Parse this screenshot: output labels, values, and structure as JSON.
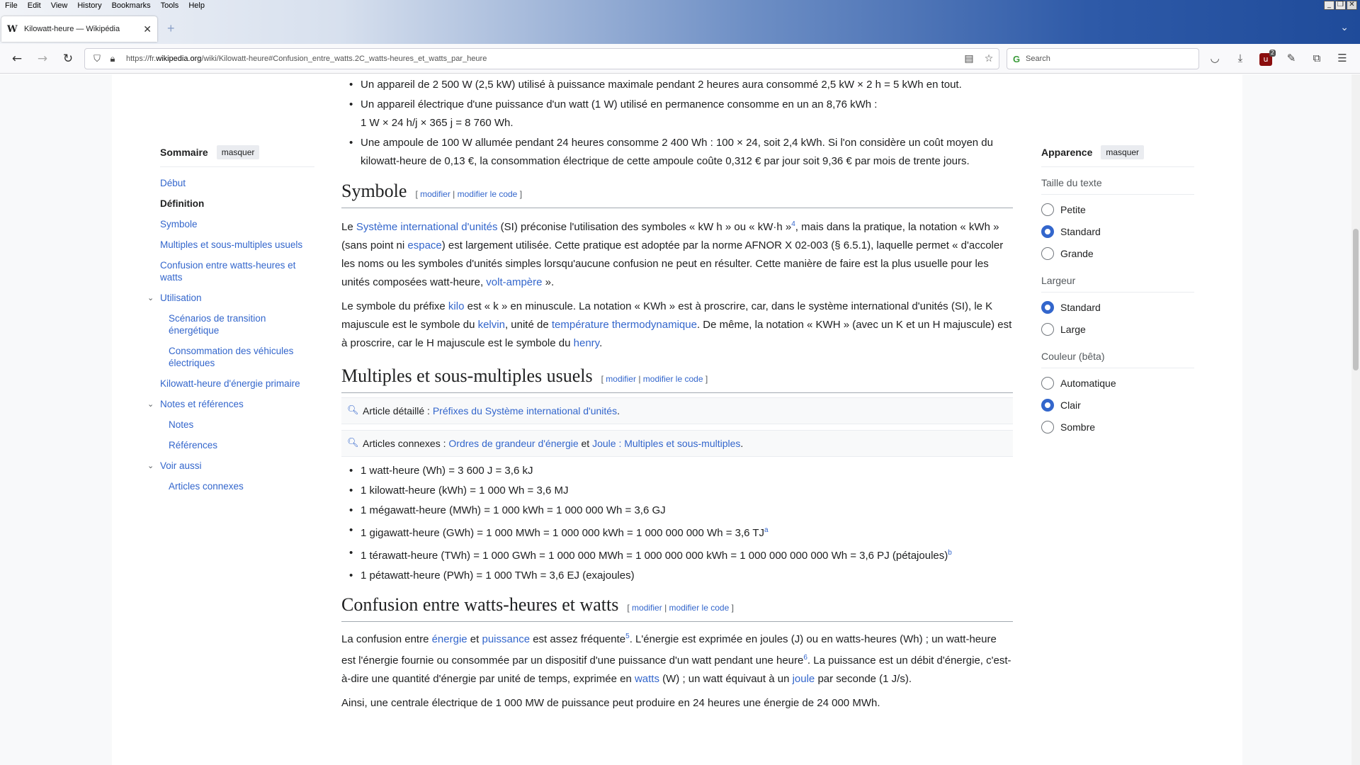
{
  "browser": {
    "menu": [
      "File",
      "Edit",
      "View",
      "History",
      "Bookmarks",
      "Tools",
      "Help"
    ],
    "tab_title": "Kilowatt-heure — Wikipédia",
    "tab_favicon": "W",
    "url_prefix": "https://fr.",
    "url_domain": "wikipedia.org",
    "url_path": "/wiki/Kilowatt-heure#Confusion_entre_watts.2C_watts-heures_et_watts_par_heure",
    "search_placeholder": "Search",
    "ublock_badge": "2"
  },
  "toc": {
    "title": "Sommaire",
    "hide": "masquer",
    "items": [
      {
        "label": "Début"
      },
      {
        "label": "Définition"
      },
      {
        "label": "Symbole"
      },
      {
        "label": "Multiples et sous-multiples usuels"
      },
      {
        "label": "Confusion entre watts-heures et watts"
      },
      {
        "label": "Utilisation"
      },
      {
        "label": "Scénarios de transition énergétique"
      },
      {
        "label": "Consommation des véhicules électriques"
      },
      {
        "label": "Kilowatt-heure d'énergie primaire"
      },
      {
        "label": "Notes et références"
      },
      {
        "label": "Notes"
      },
      {
        "label": "Références"
      },
      {
        "label": "Voir aussi"
      },
      {
        "label": "Articles connexes"
      }
    ]
  },
  "content": {
    "top_list": [
      "Un appareil de 2 500 W (2,5 kW) utilisé à puissance maximale pendant 2 heures aura consommé 2,5 kW × 2 h = 5 kWh en tout.",
      "Un appareil électrique d'une puissance d'un watt (1 W) utilisé en permanence consomme en un an 8,76 kWh :",
      "1 W × 24 h/j × 365 j = 8 760 Wh.",
      "Une ampoule de 100 W allumée pendant 24 heures consomme 2 400 Wh : 100 × 24, soit 2,4 kWh. Si l'on considère un coût moyen du kilowatt-heure de 0,13 €, la consommation électrique de cette ampoule coûte 0,312 € par jour soit 9,36 € par mois de trente jours."
    ],
    "edit_open": "[",
    "edit_sep": "|",
    "edit_close": "]",
    "edit_modifier": "modifier",
    "edit_code": "modifier le code",
    "symbole": {
      "heading": "Symbole",
      "p1_a": "Le ",
      "p1_link1": "Système international d'unités",
      "p1_b": " (SI) préconise l'utilisation des symboles « kW h » ou « kW·h »",
      "p1_sup": "4",
      "p1_c": ", mais dans la pratique, la notation « kWh » (sans point ni ",
      "p1_link2": "espace",
      "p1_d": ") est largement utilisée. Cette pratique est adoptée par la norme AFNOR X 02-003 (§ 6.5.1), laquelle permet « d'accoler les noms ou les symboles d'unités simples lorsqu'aucune confusion ne peut en résulter. Cette manière de faire est la plus usuelle pour les unités composées watt-heure, ",
      "p1_link3": "volt-ampère",
      "p1_e": " ».",
      "p2_a": "Le symbole du préfixe ",
      "p2_link1": "kilo",
      "p2_b": " est « k » en minuscule. La notation « KWh » est à proscrire, car, dans le système international d'unités (SI), le K majuscule est le symbole du ",
      "p2_link2": "kelvin",
      "p2_c": ", unité de ",
      "p2_link3": "température thermodynamique",
      "p2_d": ". De même, la notation « KWH » (avec un K et un H majuscule) est à proscrire, car le H majuscule est le symbole du ",
      "p2_link4": "henry",
      "p2_e": "."
    },
    "multiples": {
      "heading": "Multiples et sous-multiples usuels",
      "hat1_label": "Article détaillé : ",
      "hat1_link": "Préfixes du Système international d'unités",
      "hat1_end": ".",
      "hat2_label": "Articles connexes : ",
      "hat2_link1": "Ordres de grandeur d'énergie",
      "hat2_mid": " et ",
      "hat2_link2": "Joule : Multiples et sous-multiples",
      "hat2_end": ".",
      "items": [
        {
          "text": "1 watt-heure (Wh) = 3 600 J = 3,6 kJ",
          "sup": ""
        },
        {
          "text": "1 kilowatt-heure (kWh) = 1 000 Wh = 3,6 MJ",
          "sup": ""
        },
        {
          "text": "1 mégawatt-heure (MWh) = 1 000 kWh = 1 000 000 Wh = 3,6 GJ",
          "sup": ""
        },
        {
          "text": "1 gigawatt-heure (GWh) = 1 000 MWh = 1 000 000 kWh = 1 000 000 000 Wh = 3,6 TJ",
          "sup": "a"
        },
        {
          "text": "1 térawatt-heure (TWh) = 1 000 GWh = 1 000 000 MWh = 1 000 000 000 kWh = 1 000 000 000 000 Wh = 3,6 PJ (pétajoules)",
          "sup": "b"
        },
        {
          "text": "1 pétawatt-heure (PWh) = 1 000 TWh = 3,6 EJ (exajoules)",
          "sup": ""
        }
      ]
    },
    "confusion": {
      "heading": "Confusion entre watts-heures et watts",
      "p1_a": "La confusion entre ",
      "p1_link1": "énergie",
      "p1_b": " et ",
      "p1_link2": "puissance",
      "p1_c": " est assez fréquente",
      "p1_sup1": "5",
      "p1_d": ". L'énergie est exprimée en joules (J) ou en watts-heures (Wh) ; un watt-heure est l'énergie fournie ou consommée par un dispositif d'une puissance d'un watt pendant une heure",
      "p1_sup2": "6",
      "p1_e": ". La puissance est un débit d'énergie, c'est-à-dire une quantité d'énergie par unité de temps, exprimée en ",
      "p1_link3": "watts",
      "p1_f": " (W) ; un watt équivaut à un ",
      "p1_link4": "joule",
      "p1_g": " par seconde (1 J/s).",
      "p2": "Ainsi, une centrale électrique de 1 000 MW de puissance peut produire en 24 heures une énergie de 24 000 MWh."
    }
  },
  "appearance": {
    "title": "Apparence",
    "hide": "masquer",
    "groups": [
      {
        "label": "Taille du texte",
        "options": [
          {
            "label": "Petite",
            "selected": false
          },
          {
            "label": "Standard",
            "selected": true
          },
          {
            "label": "Grande",
            "selected": false
          }
        ]
      },
      {
        "label": "Largeur",
        "options": [
          {
            "label": "Standard",
            "selected": true
          },
          {
            "label": "Large",
            "selected": false
          }
        ]
      },
      {
        "label": "Couleur (bêta)",
        "options": [
          {
            "label": "Automatique",
            "selected": false
          },
          {
            "label": "Clair",
            "selected": true
          },
          {
            "label": "Sombre",
            "selected": false
          }
        ]
      }
    ]
  }
}
